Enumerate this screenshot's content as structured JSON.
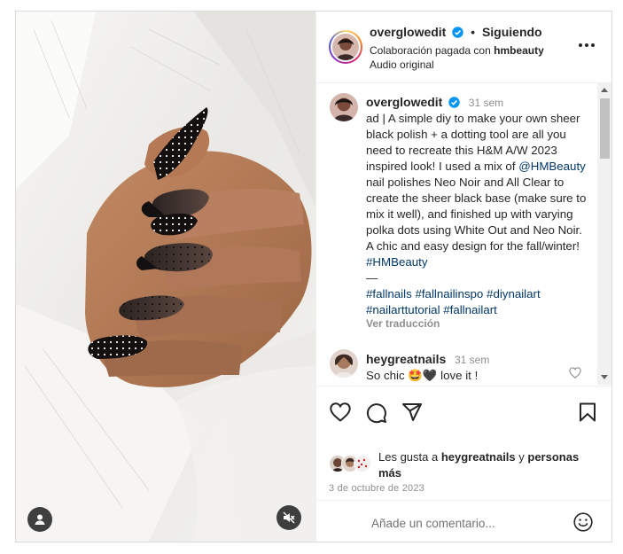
{
  "header": {
    "username": "overglowedit",
    "verified": true,
    "separator": "•",
    "follow_status": "Siguiendo",
    "paid_partnership_prefix": "Colaboración pagada con ",
    "partner": "hmbeauty",
    "audio": "Audio original"
  },
  "caption": {
    "username": "overglowedit",
    "time": "31 sem",
    "text_1": "ad | A simple diy to make your own sheer black polish + a dotting tool are all you need to recreate this H&M A/W 2023 inspired look! I used a mix of ",
    "mention": "@HMBeauty",
    "text_2": " nail polishes Neo Noir and All Clear to create the sheer black base (make sure to mix it well), and finished up with varying polka dots using White Out and Neo Noir. A chic and easy design for the fall/winter! ",
    "hashtag_inline": "#HMBeauty",
    "dash": "—",
    "hashtags": [
      "#fallnails",
      "#fallnailinspo",
      "#diynailart",
      "#nailarttutorial",
      "#fallnailart"
    ],
    "see_translation": "Ver traducción"
  },
  "comment": {
    "username": "heygreatnails",
    "time": "31 sem",
    "text": "So chic",
    "emoji_1": "🤩",
    "emoji_2": "🖤",
    "text_after": "love it !"
  },
  "likes": {
    "prefix": "Les gusta a ",
    "user": "heygreatnails",
    "suffix": " y ",
    "others": "personas más"
  },
  "date": "3 de octubre de 2023",
  "add_comment": {
    "placeholder": "Añade un comentario..."
  },
  "icons": {
    "like": "heart-icon",
    "comment": "comment-icon",
    "share": "paper-plane-icon",
    "save": "bookmark-icon",
    "emoji": "smiley-icon",
    "more": "more-options-icon",
    "user_tag": "user-tag-icon",
    "mute": "speaker-muted-icon"
  },
  "colors": {
    "verified_blue": "#0095f6",
    "link_blue": "#00376b",
    "muted_gray": "#8e8e8e"
  }
}
